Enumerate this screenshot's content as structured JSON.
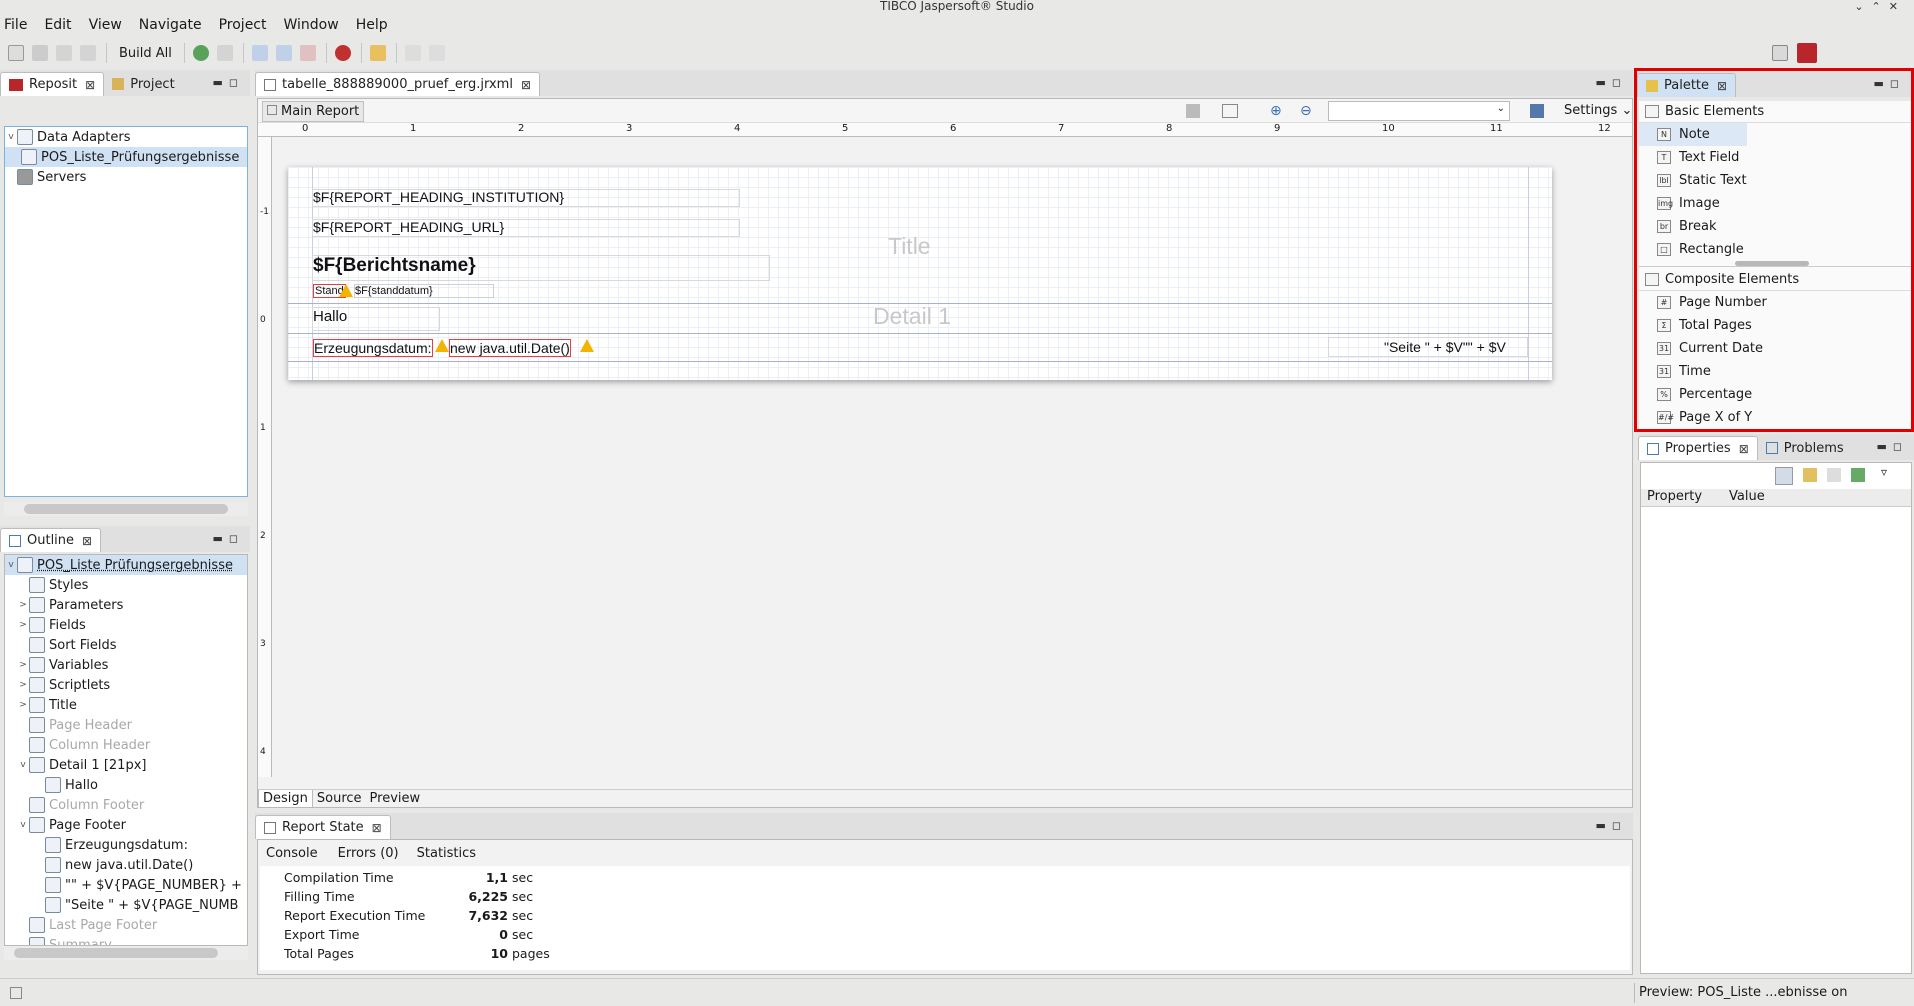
{
  "window": {
    "title": "TIBCO Jaspersoft® Studio"
  },
  "menu": [
    "File",
    "Edit",
    "View",
    "Navigate",
    "Project",
    "Window",
    "Help"
  ],
  "toolbar": {
    "build_all": "Build All"
  },
  "repo_panel": {
    "tabs": [
      "Reposit",
      "Project"
    ],
    "tree": [
      {
        "label": "Data Adapters",
        "level": 0
      },
      {
        "label": "POS_Liste_Prüfungsergebnisse",
        "level": 1
      },
      {
        "label": "Servers",
        "level": 0
      }
    ]
  },
  "outline": {
    "tab": "Outline",
    "root": "POS_Liste Prüfungsergebnisse",
    "items": [
      {
        "label": "Styles",
        "level": 1,
        "dim": false,
        "caret": ""
      },
      {
        "label": "Parameters",
        "level": 1,
        "dim": false,
        "caret": ">"
      },
      {
        "label": "Fields",
        "level": 1,
        "dim": false,
        "caret": ">"
      },
      {
        "label": "Sort Fields",
        "level": 1,
        "dim": false,
        "caret": ""
      },
      {
        "label": "Variables",
        "level": 1,
        "dim": false,
        "caret": ">"
      },
      {
        "label": "Scriptlets",
        "level": 1,
        "dim": false,
        "caret": ">"
      },
      {
        "label": "Title",
        "level": 1,
        "dim": false,
        "caret": ">"
      },
      {
        "label": "Page Header",
        "level": 1,
        "dim": true,
        "caret": ""
      },
      {
        "label": "Column Header",
        "level": 1,
        "dim": true,
        "caret": ""
      },
      {
        "label": "Detail 1 [21px]",
        "level": 1,
        "dim": false,
        "caret": "v"
      },
      {
        "label": "Hallo",
        "level": 2,
        "dim": false,
        "caret": ""
      },
      {
        "label": "Column Footer",
        "level": 1,
        "dim": true,
        "caret": ""
      },
      {
        "label": "Page Footer",
        "level": 1,
        "dim": false,
        "caret": "v"
      },
      {
        "label": "Erzeugungsdatum:",
        "level": 2,
        "dim": false,
        "caret": ""
      },
      {
        "label": "new java.util.Date()",
        "level": 2,
        "dim": false,
        "caret": ""
      },
      {
        "label": "\"\" + $V{PAGE_NUMBER} +",
        "level": 2,
        "dim": false,
        "caret": ""
      },
      {
        "label": "\"Seite \" + $V{PAGE_NUMB",
        "level": 2,
        "dim": false,
        "caret": ""
      },
      {
        "label": "Last Page Footer",
        "level": 1,
        "dim": true,
        "caret": ""
      },
      {
        "label": "Summary",
        "level": 1,
        "dim": true,
        "caret": ""
      }
    ]
  },
  "editor": {
    "tab": "tabelle_888889000_pruef_erg.jrxml",
    "main_report": "Main Report",
    "settings": "Settings",
    "ruler": [
      "0",
      "1",
      "2",
      "3",
      "4",
      "5",
      "6",
      "7",
      "8",
      "9",
      "10",
      "11",
      "12"
    ],
    "vruler": [
      "-1",
      "0",
      "1",
      "2",
      "3",
      "4"
    ],
    "bottom_tabs": [
      "Design",
      "Source",
      "Preview"
    ],
    "report": {
      "heading_institution": "$F{REPORT_HEADING_INSTITUTION}",
      "heading_url": "$F{REPORT_HEADING_URL}",
      "berichtsname": "$F{Berichtsname}",
      "stand": "Stand",
      "standdatum": "$F{standdatum}",
      "title_band": "Title",
      "hallo": "Hallo",
      "detail_band": "Detail 1",
      "erzeugungsdatum": "Erzeugungsdatum:",
      "date_expr": "new java.util.Date()",
      "seite_expr": "\"Seite \" + $V\"\" + $V"
    }
  },
  "palette": {
    "tab": "Palette",
    "basic_header": "Basic Elements",
    "basic": [
      {
        "label": "Note",
        "icon": "N"
      },
      {
        "label": "Text Field",
        "icon": "T"
      },
      {
        "label": "Static Text",
        "icon": "lbl"
      },
      {
        "label": "Image",
        "icon": "img"
      },
      {
        "label": "Break",
        "icon": "br"
      },
      {
        "label": "Rectangle",
        "icon": "□"
      }
    ],
    "composite_header": "Composite Elements",
    "composite": [
      {
        "label": "Page Number",
        "icon": "#"
      },
      {
        "label": "Total Pages",
        "icon": "Σ"
      },
      {
        "label": "Current Date",
        "icon": "31"
      },
      {
        "label": "Time",
        "icon": "31"
      },
      {
        "label": "Percentage",
        "icon": "%"
      },
      {
        "label": "Page X of Y",
        "icon": "#/#"
      }
    ]
  },
  "properties": {
    "tabs": [
      "Properties",
      "Problems"
    ],
    "col_property": "Property",
    "col_value": "Value"
  },
  "report_state": {
    "tab": "Report State",
    "subtabs": [
      "Console",
      "Errors (0)",
      "Statistics"
    ],
    "rows": [
      {
        "label": "Compilation Time",
        "value": "1,1",
        "unit": "sec"
      },
      {
        "label": "Filling Time",
        "value": "6,225",
        "unit": "sec"
      },
      {
        "label": "Report Execution Time",
        "value": "7,632",
        "unit": "sec"
      },
      {
        "label": "Export Time",
        "value": "0",
        "unit": "sec"
      },
      {
        "label": "Total Pages",
        "value": "10",
        "unit": "pages"
      }
    ]
  },
  "statusbar": {
    "right": "Preview: POS_Liste ...ebnisse on"
  },
  "colors": {
    "highlight": "#e00000",
    "selection": "#cfe1f3"
  }
}
